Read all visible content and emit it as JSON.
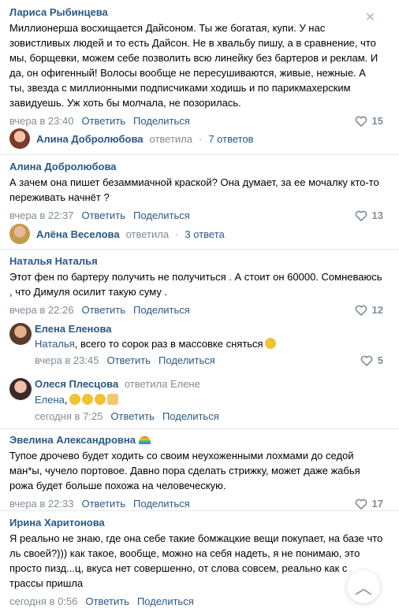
{
  "comments": [
    {
      "author": "Лариса Рыбинцева",
      "text": "Миллионерша восхищается Дайсоном. Ты же богатая, купи. У нас зовистливых людей и то есть Дайсон. Не в хвальбу пишу, а в сравнение, что мы, борщевки, можем себе позволить всю линейку без бартеров и реклам. И да, он офигенный! Волосы вообще не пересушиваются, живые, нежные. А ты, звезда с миллионными подписчиками ходишь и по парикмахерским завидуешь. Уж хоть бы молчала, не позорилась.",
      "time": "вчера в 23:40",
      "reply_label": "Ответить",
      "share_label": "Поделиться",
      "likes": "15"
    },
    {
      "author": "Алина Добролюбова",
      "text": "А зачем она пишет безаммиачной краской? Она думает, за ее мочалку кто-то переживать начнёт ?",
      "time": "вчера в 22:37",
      "reply_label": "Ответить",
      "share_label": "Поделиться",
      "likes": "13"
    },
    {
      "author": "Наталья Наталья",
      "text": "Этот фен по бартеру получить не получиться . А стоит он 60000. Сомневаюсь , что Димуля осилит такую суму .",
      "time": "вчера в 22:26",
      "reply_label": "Ответить",
      "share_label": "Поделиться",
      "likes": "12"
    },
    {
      "author": "Эвелина Александровна",
      "text": "Тупое дрочево будет ходить со своим неухоженными лохмами до седой ман*ы, чучело портовое. Давно пора сделать стрижку, может даже жабья рожа будет больше похожа на человеческую.",
      "time": "вчера в 22:33",
      "reply_label": "Ответить",
      "share_label": "Поделиться",
      "likes": "17"
    },
    {
      "author": "Ирина Харитонова",
      "text": "Я реально не знаю, где она себе такие бомжацкие вещи покупает, на базе что ль своей?))) как такое, вообще, можно на себя надеть, я не понимаю, это просто пизд...ц, вкуса нет совершенно, от слова совсем, реально как с трассы пришла",
      "time": "сегодня в 0:56",
      "reply_label": "Ответить",
      "share_label": "Поделиться"
    }
  ],
  "reply_summaries": [
    {
      "name": "Алина Добролюбова",
      "action": "ответила",
      "sep": "·",
      "count": "7 ответов"
    },
    {
      "name": "Алёна Веселова",
      "action": "ответила",
      "sep": "·",
      "count": "3 ответа"
    }
  ],
  "replies": [
    {
      "author": "Елена Еленова",
      "mention": "Наталья",
      "text": ", всего то сорок раз в массовке сняться",
      "time": "вчера в 23:45",
      "reply_label": "Ответить",
      "share_label": "Поделиться",
      "likes": "5"
    },
    {
      "author": "Олеся Плесцова",
      "answered_to": "ответила Елене",
      "mention": "Елена",
      "text": ",",
      "time": "сегодня в 7:25",
      "reply_label": "Ответить",
      "share_label": "Поделиться"
    }
  ],
  "icons": {
    "close": "close-icon",
    "heart": "heart-icon",
    "scroll": "chevron-up-icon"
  },
  "colors": {
    "link": "#2a5885",
    "meta": "#818c99",
    "separator": "#e7e8ec"
  }
}
